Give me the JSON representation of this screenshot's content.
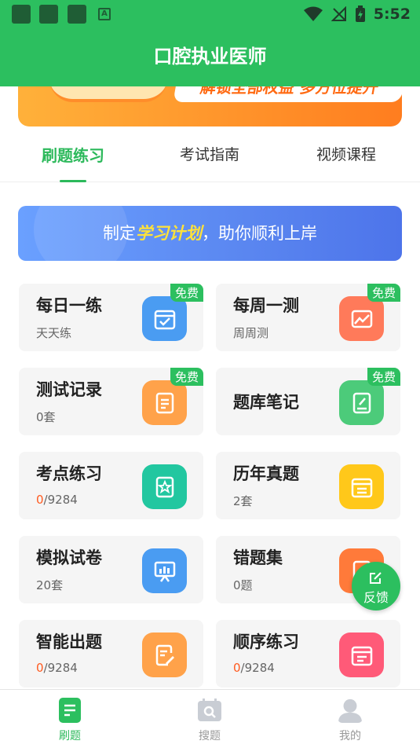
{
  "status_bar": {
    "time": "5:52",
    "notif_icon_letter": "A"
  },
  "app": {
    "title": "口腔执业医师"
  },
  "banner": {
    "text": "解锁全部权益  多方位提升"
  },
  "tabs": [
    {
      "label": "刷题练习",
      "active": true
    },
    {
      "label": "考试指南",
      "active": false
    },
    {
      "label": "视频课程",
      "active": false
    }
  ],
  "plan": {
    "prefix": "制定",
    "highlight": "学习计划",
    "suffix": "，助你顺利上岸"
  },
  "cards": [
    {
      "title": "每日一练",
      "sub": "天天练",
      "badge": "免费",
      "icon": "calendar-check-icon",
      "color": "#4a9cf2"
    },
    {
      "title": "每周一测",
      "sub": "周周测",
      "badge": "免费",
      "icon": "chart-image-icon",
      "color": "#ff7a5a"
    },
    {
      "title": "测试记录",
      "sub": "0套",
      "badge": "免费",
      "icon": "document-icon",
      "color": "#ffa24a"
    },
    {
      "title": "题库笔记",
      "sub": "",
      "badge": "免费",
      "icon": "notebook-pen-icon",
      "color": "#4ccb7a"
    },
    {
      "title": "考点练习",
      "sub_hl": "0",
      "sub_rest": "/9284",
      "icon": "star-book-icon",
      "color": "#22c7a0"
    },
    {
      "title": "历年真题",
      "sub": "2套",
      "icon": "calendar-icon",
      "color": "#ffc81a"
    },
    {
      "title": "模拟试卷",
      "sub": "20套",
      "icon": "presentation-icon",
      "color": "#4a9cf2"
    },
    {
      "title": "错题集",
      "sub": "0题",
      "icon": "wrong-book-icon",
      "color": "#ff7a3a"
    },
    {
      "title": "智能出题",
      "sub_hl": "0",
      "sub_rest": "/9284",
      "icon": "edit-doc-icon",
      "color": "#ffa24a"
    },
    {
      "title": "顺序练习",
      "sub_hl": "0",
      "sub_rest": "/9284",
      "icon": "order-calendar-icon",
      "color": "#ff5a78"
    }
  ],
  "feedback": {
    "label": "反馈"
  },
  "bottom_nav": [
    {
      "label": "刷题",
      "icon": "quiz-doc-icon",
      "active": true
    },
    {
      "label": "搜题",
      "icon": "search-icon",
      "active": false
    },
    {
      "label": "我的",
      "icon": "user-icon",
      "active": false
    }
  ],
  "colors": {
    "primary": "#2cbf5f",
    "highlight": "#ff5a1f",
    "plan_blue": "#5a86f0"
  }
}
